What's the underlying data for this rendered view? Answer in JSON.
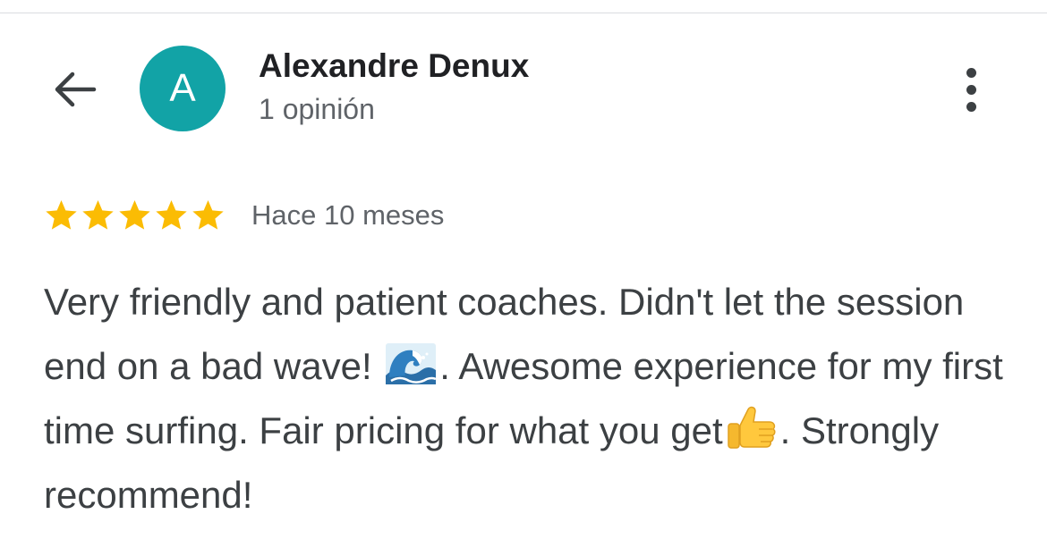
{
  "header": {
    "back_icon": "arrow-back-icon",
    "more_icon": "more-vert-icon"
  },
  "reviewer": {
    "avatar_letter": "A",
    "avatar_color": "#12a3a6",
    "name": "Alexandre Denux",
    "review_count": "1 opinión"
  },
  "review": {
    "rating": 5,
    "max_rating": 5,
    "star_color": "#fbbc04",
    "time_ago": "Hace 10 meses",
    "text_part1": "Very friendly and patient coaches. Didn't let the session end on a bad wave! ",
    "emoji1": "wave-emoji",
    "text_part2": ". Awesome experience for my first time surfing. Fair pricing for what you get",
    "emoji2": "thumbs-up-emoji",
    "text_part3": ". Strongly recommend!"
  }
}
